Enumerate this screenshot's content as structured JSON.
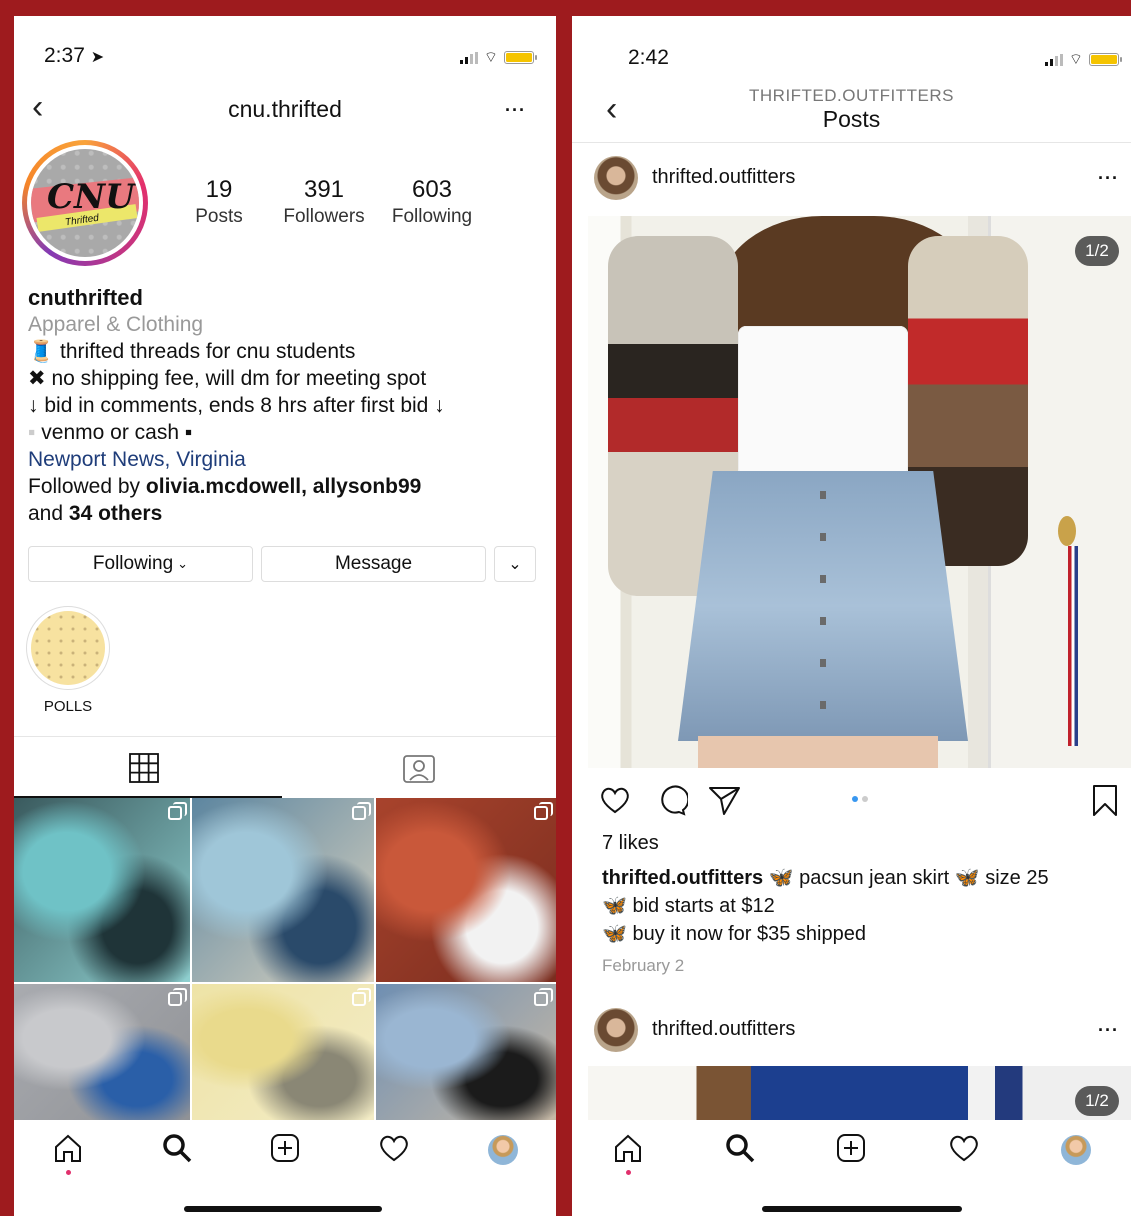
{
  "left": {
    "status": {
      "time": "2:37"
    },
    "header": {
      "username": "cnu.thrifted"
    },
    "profile": {
      "logo_text": "CNU",
      "logo_subtext": "Thrifted",
      "stats": [
        {
          "value": "19",
          "label": "Posts"
        },
        {
          "value": "391",
          "label": "Followers"
        },
        {
          "value": "603",
          "label": "Following"
        }
      ],
      "name": "cnuthrifted",
      "category": "Apparel & Clothing",
      "bio": [
        {
          "icon": "🧵",
          "text": "thrifted threads for cnu students"
        },
        {
          "icon": "✖",
          "text": "no shipping fee, will dm for meeting spot"
        },
        {
          "icon": "↓",
          "text": "bid in comments, ends 8 hrs after first bid ↓"
        },
        {
          "icon": "▪",
          "text": "venmo or cash ▪"
        }
      ],
      "location": "Newport News, Virginia",
      "followed_by_prefix": "Followed by",
      "followed_by_names": "olivia.mcdowell, allysonb99",
      "followed_by_and": "and",
      "followed_by_others": "34 others"
    },
    "buttons": {
      "following": "Following",
      "message": "Message"
    },
    "highlight": {
      "label": "POLLS"
    },
    "grid": [
      {
        "colors": [
          "#3a5a5e",
          "#6fc2c6",
          "#1f3438",
          "#8fd0d0"
        ]
      },
      {
        "colors": [
          "#5d86a0",
          "#9fc6d8",
          "#2a4a6a",
          "#d9d2c0"
        ]
      },
      {
        "colors": [
          "#a8432c",
          "#c9583a",
          "#f2f2f2",
          "#7a2d1f"
        ]
      },
      {
        "colors": [
          "#a9abb0",
          "#c8c9cc",
          "#2a5fa8",
          "#909296"
        ]
      },
      {
        "colors": [
          "#eee3a6",
          "#e9da8c",
          "#8a8775",
          "#f3ecc6"
        ]
      },
      {
        "colors": [
          "#6f8fb2",
          "#9ab6d2",
          "#1b1b1b",
          "#c7b9a6"
        ]
      }
    ]
  },
  "right": {
    "status": {
      "time": "2:42"
    },
    "header": {
      "account": "THRIFTED.OUTFITTERS",
      "title": "Posts"
    },
    "post": {
      "username": "thrifted.outfitters",
      "counter": "1/2",
      "likes": "7 likes",
      "caption_user": "thrifted.outfitters",
      "caption_line1": "🦋 pacsun jean skirt 🦋 size 25",
      "caption_line2": "🦋 bid starts at $12",
      "caption_line3": "🦋 buy it now for $35 shipped",
      "date": "February 2"
    },
    "post2": {
      "username": "thrifted.outfitters",
      "counter": "1/2"
    }
  }
}
